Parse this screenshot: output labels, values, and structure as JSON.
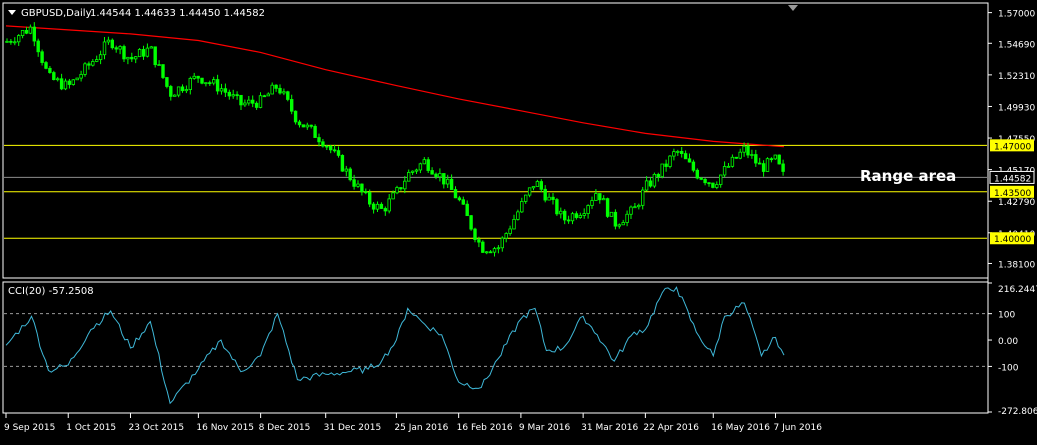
{
  "window": {
    "symbol_label": "GBPUSD,Daily",
    "ohlc_label": "1.44544 1.44633 1.44450 1.44582",
    "indicator_label": "CCI(20) -57.2508",
    "annotation": "Range area",
    "menu_arrow": "triangle-down-icon"
  },
  "colors": {
    "background": "#000000",
    "frame": "#ffffff",
    "candle": "#00ff00",
    "moving_average": "#ff0000",
    "level_line": "#ffff00",
    "level_tag_bg": "#ffff00",
    "current_price_line": "#8c8c8c",
    "cci_line": "#3fb8d8",
    "cci_levels": "#9a9a9a",
    "axis_text": "#ffffff"
  },
  "chart_data": [
    {
      "type": "candlestick",
      "title": "GBPUSD,Daily",
      "ylim": [
        1.3708,
        1.5765
      ],
      "y_ticks": [
        "1.57000",
        "1.54690",
        "1.52310",
        "1.49930",
        "1.47550",
        "1.45170",
        "1.42790",
        "1.40410",
        "1.38100"
      ],
      "x_ticks": [
        "9 Sep 2015",
        "1 Oct 2015",
        "23 Oct 2015",
        "16 Nov 2015",
        "8 Dec 2015",
        "31 Dec 2015",
        "25 Jan 2016",
        "16 Feb 2016",
        "9 Mar 2016",
        "31 Mar 2016",
        "22 Apr 2016",
        "16 May 2016",
        "7 Jun 2016"
      ],
      "close_points": [
        [
          "9 Sep 2015",
          1.548
        ],
        [
          "18 Sep 2015",
          1.559
        ],
        [
          "24 Sep 2015",
          1.521
        ],
        [
          "1 Oct 2015",
          1.514
        ],
        [
          "9 Oct 2015",
          1.532
        ],
        [
          "16 Oct 2015",
          1.549
        ],
        [
          "23 Oct 2015",
          1.535
        ],
        [
          "30 Oct 2015",
          1.543
        ],
        [
          "6 Nov 2015",
          1.509
        ],
        [
          "16 Nov 2015",
          1.522
        ],
        [
          "24 Nov 2015",
          1.513
        ],
        [
          "1 Dec 2015",
          1.501
        ],
        [
          "8 Dec 2015",
          1.503
        ],
        [
          "14 Dec 2015",
          1.515
        ],
        [
          "21 Dec 2015",
          1.489
        ],
        [
          "31 Dec 2015",
          1.472
        ],
        [
          "8 Jan 2016",
          1.448
        ],
        [
          "15 Jan 2016",
          1.428
        ],
        [
          "20 Jan 2016",
          1.421
        ],
        [
          "25 Jan 2016",
          1.434
        ],
        [
          "29 Jan 2016",
          1.448
        ],
        [
          "4 Feb 2016",
          1.458
        ],
        [
          "10 Feb 2016",
          1.446
        ],
        [
          "16 Feb 2016",
          1.429
        ],
        [
          "24 Feb 2016",
          1.393
        ],
        [
          "1 Mar 2016",
          1.393
        ],
        [
          "9 Mar 2016",
          1.424
        ],
        [
          "14 Mar 2016",
          1.443
        ],
        [
          "18 Mar 2016",
          1.432
        ],
        [
          "24 Mar 2016",
          1.414
        ],
        [
          "31 Mar 2016",
          1.422
        ],
        [
          "5 Apr 2016",
          1.436
        ],
        [
          "11 Apr 2016",
          1.411
        ],
        [
          "18 Apr 2016",
          1.421
        ],
        [
          "22 Apr 2016",
          1.438
        ],
        [
          "28 Apr 2016",
          1.452
        ],
        [
          "3 May 2016",
          1.466
        ],
        [
          "10 May 2016",
          1.449
        ],
        [
          "16 May 2016",
          1.441
        ],
        [
          "20 May 2016",
          1.451
        ],
        [
          "27 May 2016",
          1.467
        ],
        [
          "2 Jun 2016",
          1.453
        ],
        [
          "7 Jun 2016",
          1.459
        ],
        [
          "10 Jun 2016",
          1.44582
        ]
      ],
      "series": [
        {
          "name": "",
          "kind": "moving_average",
          "values": [
            [
              "9 Sep 2015",
              1.56
            ],
            [
              "1 Oct 2015",
              1.557
            ],
            [
              "23 Oct 2015",
              1.554
            ],
            [
              "16 Nov 2015",
              1.549
            ],
            [
              "8 Dec 2015",
              1.54
            ],
            [
              "31 Dec 2015",
              1.527
            ],
            [
              "25 Jan 2016",
              1.515
            ],
            [
              "16 Feb 2016",
              1.505
            ],
            [
              "9 Mar 2016",
              1.496
            ],
            [
              "31 Mar 2016",
              1.487
            ],
            [
              "22 Apr 2016",
              1.479
            ],
            [
              "16 May 2016",
              1.473
            ],
            [
              "10 Jun 2016",
              1.469
            ]
          ]
        }
      ],
      "horizontal_levels": [
        {
          "label": "1.47000",
          "value": 1.47,
          "color": "yellow"
        },
        {
          "label": "1.43500",
          "value": 1.435,
          "color": "yellow"
        },
        {
          "label": "1.40000",
          "value": 1.4,
          "color": "yellow"
        },
        {
          "label": "1.44582",
          "value": 1.44582,
          "color": "grey",
          "note": "current price"
        }
      ],
      "annotations": [
        "Range area"
      ]
    },
    {
      "type": "line",
      "title": "CCI(20) -57.2508",
      "ylim": [
        -272.8061,
        216.2447
      ],
      "y_ticks": [
        "216.2447",
        "100",
        "0.00",
        "-100",
        "-272.8061"
      ],
      "levels": [
        100,
        -100
      ],
      "x": [
        "9 Sep 2015",
        "18 Sep 2015",
        "24 Sep 2015",
        "1 Oct 2015",
        "9 Oct 2015",
        "16 Oct 2015",
        "23 Oct 2015",
        "30 Oct 2015",
        "6 Nov 2015",
        "16 Nov 2015",
        "24 Nov 2015",
        "1 Dec 2015",
        "8 Dec 2015",
        "14 Dec 2015",
        "21 Dec 2015",
        "31 Dec 2015",
        "8 Jan 2016",
        "15 Jan 2016",
        "20 Jan 2016",
        "25 Jan 2016",
        "29 Jan 2016",
        "4 Feb 2016",
        "10 Feb 2016",
        "16 Feb 2016",
        "24 Feb 2016",
        "1 Mar 2016",
        "9 Mar 2016",
        "14 Mar 2016",
        "18 Mar 2016",
        "24 Mar 2016",
        "31 Mar 2016",
        "5 Apr 2016",
        "11 Apr 2016",
        "18 Apr 2016",
        "22 Apr 2016",
        "28 Apr 2016",
        "3 May 2016",
        "10 May 2016",
        "16 May 2016",
        "20 May 2016",
        "27 May 2016",
        "2 Jun 2016",
        "7 Jun 2016",
        "10 Jun 2016"
      ],
      "values": [
        -20,
        90,
        -115,
        -95,
        40,
        110,
        -30,
        70,
        -240,
        -110,
        0,
        -120,
        -60,
        100,
        -150,
        -130,
        -120,
        -110,
        -75,
        0,
        120,
        60,
        20,
        -160,
        -180,
        -70,
        80,
        120,
        -40,
        -30,
        90,
        20,
        -80,
        30,
        40,
        180,
        200,
        30,
        -60,
        90,
        140,
        -60,
        10,
        -57.2508
      ]
    }
  ],
  "x_axis": {
    "labels": [
      "9 Sep 2015",
      "1 Oct 2015",
      "23 Oct 2015",
      "16 Nov 2015",
      "8 Dec 2015",
      "31 Dec 2015",
      "25 Jan 2016",
      "16 Feb 2016",
      "9 Mar 2016",
      "31 Mar 2016",
      "22 Apr 2016",
      "16 May 2016",
      "7 Jun 2016"
    ]
  }
}
